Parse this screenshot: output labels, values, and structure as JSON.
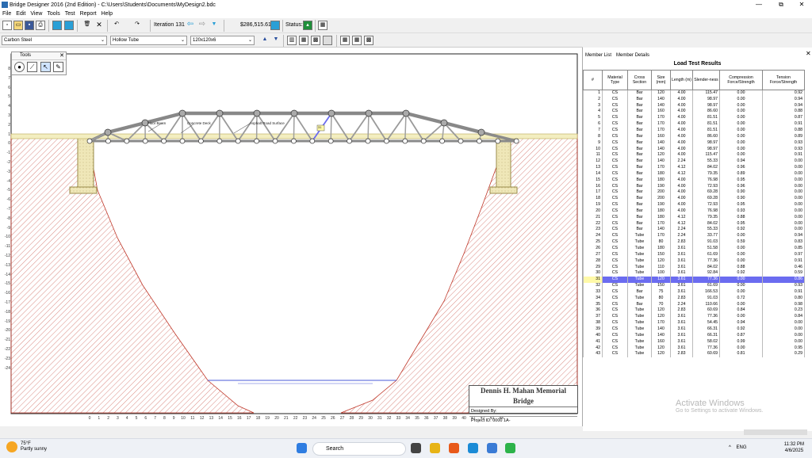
{
  "window": {
    "title": "Bridge Designer 2016 (2nd Edition) - C:\\Users\\Students\\Documents\\MyDesign2.bdc",
    "min": "—",
    "max": "⧉",
    "close": "✕"
  },
  "menu": [
    "File",
    "Edit",
    "View",
    "Tools",
    "Test",
    "Report",
    "Help"
  ],
  "toolbar": {
    "iteration": "Iteration 131",
    "cost": "$286,515.61",
    "status_label": "Status:"
  },
  "selectors": {
    "material": "Carbon Steel",
    "section": "Hollow Tube",
    "size": "120x120x6"
  },
  "tools_palette": {
    "title": "Tools",
    "close": "✕"
  },
  "canvas": {
    "y_ticks": [
      "8",
      "7",
      "6",
      "5",
      "4",
      "3",
      "2",
      "1",
      "0",
      "-1",
      "-2",
      "-3",
      "-4",
      "-5",
      "-6",
      "-7",
      "-8",
      "-9",
      "-10",
      "-11",
      "-12",
      "-13",
      "-14",
      "-15",
      "-16",
      "-17",
      "-18",
      "-19",
      "-20",
      "-21",
      "-22",
      "-23",
      "-24"
    ],
    "x_ticks": [
      "0",
      "1",
      "2",
      "3",
      "4",
      "5",
      "6",
      "7",
      "8",
      "9",
      "10",
      "11",
      "12",
      "13",
      "14",
      "15",
      "16",
      "17",
      "18",
      "19",
      "20",
      "21",
      "22",
      "23",
      "24",
      "25",
      "26",
      "27",
      "28",
      "29",
      "30",
      "31",
      "32",
      "33",
      "34",
      "35",
      "36",
      "37",
      "38",
      "39",
      "40",
      "41",
      "42",
      "43",
      "44"
    ],
    "labels": {
      "floor_beam": "Floor Beam",
      "concrete_deck": "Concrete Deck",
      "asphalt": "Asphalt Road Surface",
      "selected_tag": "31"
    }
  },
  "title_block": {
    "name": "Dennis H. Mahan Memorial Bridge",
    "designed_by": "Designed By:",
    "project_id": "Project ID: 0000 1A-"
  },
  "panel": {
    "tabs": [
      "Member List",
      "Member Details"
    ],
    "close": "✕",
    "title": "Load Test Results",
    "headers": [
      "#",
      "Material Type",
      "Cross Section",
      "Size (mm)",
      "Length (m)",
      "Slender-ness",
      "Compression Force/Strength",
      "Tension Force/Strength"
    ],
    "rows": [
      [
        "1",
        "CS",
        "Bar",
        "120",
        "4.00",
        "115.47",
        "0.00",
        "0.92"
      ],
      [
        "2",
        "CS",
        "Bar",
        "140",
        "4.00",
        "98.97",
        "0.00",
        "0.94"
      ],
      [
        "3",
        "CS",
        "Bar",
        "140",
        "4.00",
        "98.97",
        "0.00",
        "0.94"
      ],
      [
        "4",
        "CS",
        "Bar",
        "160",
        "4.00",
        "86.60",
        "0.00",
        "0.88"
      ],
      [
        "5",
        "CS",
        "Bar",
        "170",
        "4.00",
        "81.51",
        "0.00",
        "0.87"
      ],
      [
        "6",
        "CS",
        "Bar",
        "170",
        "4.00",
        "81.51",
        "0.00",
        "0.91"
      ],
      [
        "7",
        "CS",
        "Bar",
        "170",
        "4.00",
        "81.51",
        "0.00",
        "0.88"
      ],
      [
        "8",
        "CS",
        "Bar",
        "160",
        "4.00",
        "86.60",
        "0.00",
        "0.89"
      ],
      [
        "9",
        "CS",
        "Bar",
        "140",
        "4.00",
        "98.97",
        "0.00",
        "0.93"
      ],
      [
        "10",
        "CS",
        "Bar",
        "140",
        "4.00",
        "98.97",
        "0.00",
        "0.93"
      ],
      [
        "11",
        "CS",
        "Bar",
        "120",
        "4.00",
        "115.47",
        "0.00",
        "0.91"
      ],
      [
        "12",
        "CS",
        "Bar",
        "140",
        "2.24",
        "55.33",
        "0.94",
        "0.00"
      ],
      [
        "13",
        "CS",
        "Bar",
        "170",
        "4.12",
        "84.02",
        "0.96",
        "0.00"
      ],
      [
        "14",
        "CS",
        "Bar",
        "180",
        "4.12",
        "79.35",
        "0.89",
        "0.00"
      ],
      [
        "15",
        "CS",
        "Bar",
        "180",
        "4.00",
        "76.98",
        "0.95",
        "0.00"
      ],
      [
        "16",
        "CS",
        "Bar",
        "190",
        "4.00",
        "72.93",
        "0.96",
        "0.00"
      ],
      [
        "17",
        "CS",
        "Bar",
        "200",
        "4.00",
        "69.28",
        "0.90",
        "0.00"
      ],
      [
        "18",
        "CS",
        "Bar",
        "200",
        "4.00",
        "69.28",
        "0.90",
        "0.00"
      ],
      [
        "19",
        "CS",
        "Bar",
        "190",
        "4.00",
        "72.93",
        "0.95",
        "0.00"
      ],
      [
        "20",
        "CS",
        "Bar",
        "180",
        "4.00",
        "76.98",
        "0.93",
        "0.00"
      ],
      [
        "21",
        "CS",
        "Bar",
        "180",
        "4.12",
        "79.35",
        "0.88",
        "0.00"
      ],
      [
        "22",
        "CS",
        "Bar",
        "170",
        "4.12",
        "84.02",
        "0.95",
        "0.00"
      ],
      [
        "23",
        "CS",
        "Bar",
        "140",
        "2.24",
        "55.33",
        "0.92",
        "0.00"
      ],
      [
        "24",
        "CS",
        "Tube",
        "170",
        "2.24",
        "33.77",
        "0.00",
        "0.94"
      ],
      [
        "25",
        "CS",
        "Tube",
        "80",
        "2.83",
        "91.03",
        "0.59",
        "0.83"
      ],
      [
        "26",
        "CS",
        "Tube",
        "180",
        "3.61",
        "51.58",
        "0.00",
        "0.85"
      ],
      [
        "27",
        "CS",
        "Tube",
        "150",
        "3.61",
        "61.69",
        "0.00",
        "0.97"
      ],
      [
        "28",
        "CS",
        "Tube",
        "120",
        "3.61",
        "77.36",
        "0.00",
        "0.91"
      ],
      [
        "29",
        "CS",
        "Tube",
        "110",
        "3.61",
        "84.02",
        "0.88",
        "0.46"
      ],
      [
        "30",
        "CS",
        "Tube",
        "100",
        "3.61",
        "92.84",
        "0.92",
        "0.59"
      ],
      [
        "31",
        "CS",
        "Tube",
        "120",
        "3.61",
        "77.36",
        "0.00",
        "0.86"
      ],
      [
        "32",
        "CS",
        "Tube",
        "150",
        "3.61",
        "61.69",
        "0.00",
        "0.93"
      ],
      [
        "33",
        "CS",
        "Bar",
        "75",
        "3.61",
        "166.53",
        "0.00",
        "0.91"
      ],
      [
        "34",
        "CS",
        "Tube",
        "80",
        "2.83",
        "91.03",
        "0.72",
        "0.80"
      ],
      [
        "35",
        "CS",
        "Bar",
        "70",
        "2.24",
        "110.66",
        "0.00",
        "0.98"
      ],
      [
        "36",
        "CS",
        "Tube",
        "120",
        "2.83",
        "60.69",
        "0.84",
        "0.23"
      ],
      [
        "37",
        "CS",
        "Tube",
        "120",
        "3.61",
        "77.36",
        "0.00",
        "0.84"
      ],
      [
        "38",
        "CS",
        "Tube",
        "170",
        "3.61",
        "54.45",
        "0.94",
        "0.00"
      ],
      [
        "39",
        "CS",
        "Tube",
        "140",
        "3.61",
        "66.31",
        "0.92",
        "0.00"
      ],
      [
        "40",
        "CS",
        "Tube",
        "140",
        "3.61",
        "66.31",
        "0.87",
        "0.00"
      ],
      [
        "41",
        "CS",
        "Tube",
        "160",
        "3.61",
        "58.02",
        "0.99",
        "0.00"
      ],
      [
        "42",
        "CS",
        "Tube",
        "120",
        "3.61",
        "77.36",
        "0.00",
        "0.95"
      ],
      [
        "43",
        "CS",
        "Tube",
        "120",
        "2.83",
        "60.69",
        "0.81",
        "0.29"
      ]
    ],
    "selected_row": "31"
  },
  "watermark": {
    "line1": "Activate Windows",
    "line2": "Go to Settings to activate Windows."
  },
  "taskbar": {
    "temp": "75°F",
    "weather": "Partly sunny",
    "search": "Search",
    "lang": "ENG",
    "time": "11:32 PM",
    "date": "4/6/2025"
  },
  "colors": {
    "selection": "#6b6cf0",
    "deck": "#f3eec0",
    "truss": "#8a8a8a",
    "terrain_hatch": "#c0392b"
  }
}
